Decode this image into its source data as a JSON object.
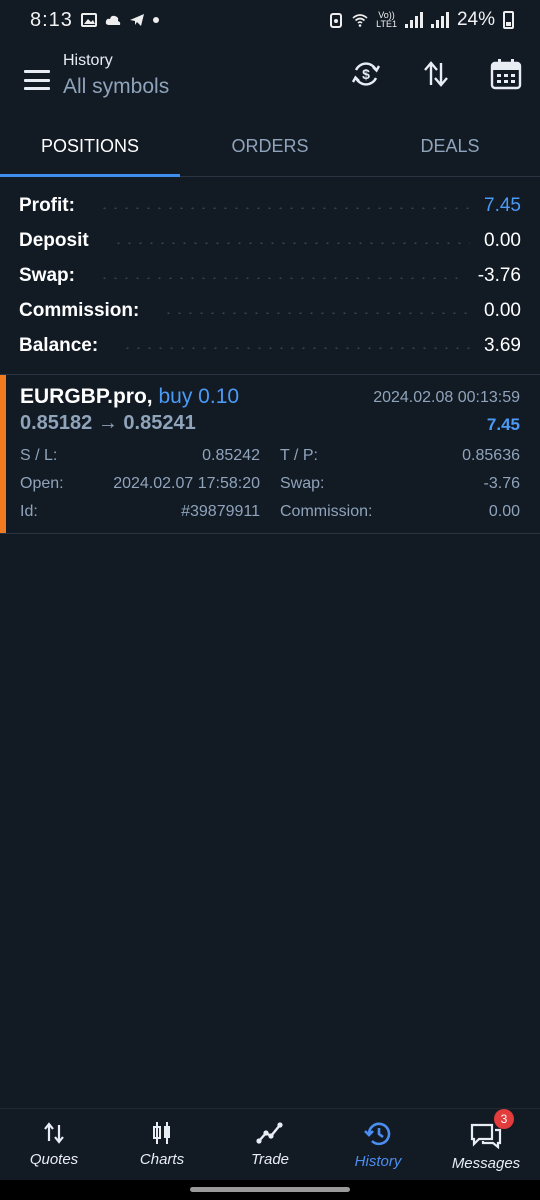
{
  "status_bar": {
    "time": "8:13",
    "battery": "24%",
    "network_label": "Vo))\nLTE1"
  },
  "header": {
    "title": "History",
    "subtitle": "All symbols"
  },
  "tabs": [
    {
      "label": "POSITIONS",
      "active": true
    },
    {
      "label": "ORDERS",
      "active": false
    },
    {
      "label": "DEALS",
      "active": false
    }
  ],
  "summary": {
    "profit": {
      "label": "Profit:",
      "value": "7.45"
    },
    "deposit": {
      "label": "Deposit",
      "value": "0.00"
    },
    "swap": {
      "label": "Swap:",
      "value": "-3.76"
    },
    "commission": {
      "label": "Commission:",
      "value": "0.00"
    },
    "balance": {
      "label": "Balance:",
      "value": "3.69"
    }
  },
  "position": {
    "symbol": "EURGBP.pro,",
    "side": "buy 0.10",
    "close_time": "2024.02.08 00:13:59",
    "prices": "0.85182 → 0.85241",
    "profit": "7.45",
    "sl_label": "S / L:",
    "sl_value": "0.85242",
    "tp_label": "T / P:",
    "tp_value": "0.85636",
    "open_label": "Open:",
    "open_value": "2024.02.07 17:58:20",
    "swap_label": "Swap:",
    "swap_value": "-3.76",
    "id_label": "Id:",
    "id_value": "#39879911",
    "commission_label": "Commission:",
    "commission_value": "0.00",
    "side_color": "#f07b20"
  },
  "bottom_nav": [
    {
      "label": "Quotes",
      "icon": "quotes-arrows-icon",
      "active": false
    },
    {
      "label": "Charts",
      "icon": "candlestick-icon",
      "active": false
    },
    {
      "label": "Trade",
      "icon": "trade-line-icon",
      "active": false
    },
    {
      "label": "History",
      "icon": "history-clock-icon",
      "active": true
    },
    {
      "label": "Messages",
      "icon": "chat-bubbles-icon",
      "active": false,
      "badge": "3"
    }
  ],
  "colors": {
    "background": "#121a24",
    "accent": "#4b9af5",
    "muted": "#8fa3bb",
    "buy_marker": "#f07b20",
    "badge": "#e23c3c"
  }
}
